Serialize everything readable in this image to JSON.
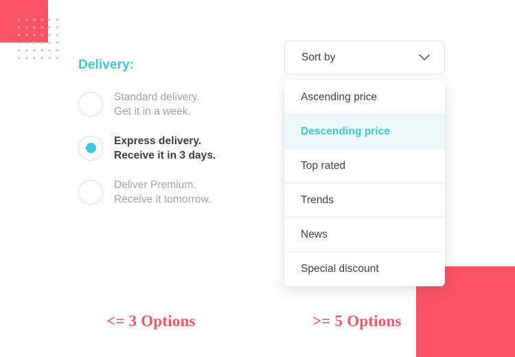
{
  "colors": {
    "accent_cyan": "#3ec8dd",
    "accent_cyan_bg": "#edf8fa",
    "coral": "#fa5364",
    "dot_pink": "#f7a8bd",
    "text_dark": "#3d3d3d",
    "text_muted": "#a2a2a2",
    "border": "#e2e2e2"
  },
  "delivery": {
    "title": "Delivery:",
    "options": [
      {
        "line1": "Standard delivery.",
        "line2": "Get it in a week.",
        "selected": false
      },
      {
        "line1": "Express delivery.",
        "line2": "Receive it in 3 days.",
        "selected": true
      },
      {
        "line1": "Deliver Premium.",
        "line2": "Receive it tomorrow.",
        "selected": false
      }
    ]
  },
  "sort": {
    "button_label": "Sort by",
    "chevron_icon": "chevron-down-icon",
    "selected_option": "Descending price",
    "options": [
      {
        "label": "Ascending price",
        "active": false
      },
      {
        "label": "Descending price",
        "active": true
      },
      {
        "label": "Top rated",
        "active": false
      },
      {
        "label": "Trends",
        "active": false
      },
      {
        "label": "News",
        "active": false
      },
      {
        "label": "Special discount",
        "active": false
      }
    ]
  },
  "captions": {
    "left": "<= 3 Options",
    "right": ">= 5 Options"
  }
}
